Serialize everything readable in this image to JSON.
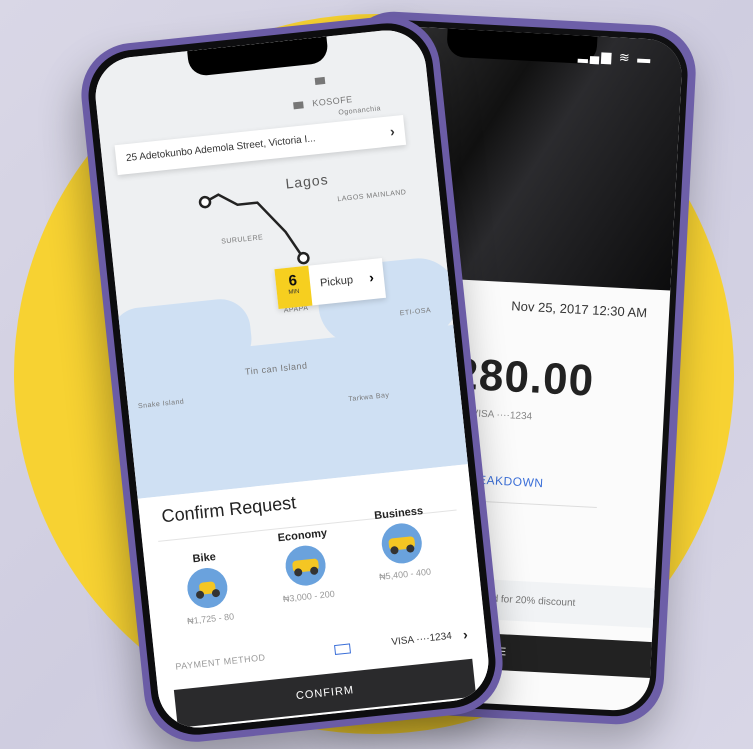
{
  "back_phone": {
    "status_icons": "▂▄▆ ≋ ▬",
    "date": "Nov 25, 2017 12:30 AM",
    "amount": "280.00",
    "card": "VISA ····1234",
    "breakdown_label": "E BREAKDOWN",
    "promo_text": "applied for 20% discount",
    "complete_label": "MPLETE"
  },
  "front_phone": {
    "map": {
      "address": "25 Adetokunbo Ademola Street, Victoria I...",
      "city_label": "Lagos",
      "labels": [
        "KOSOFE",
        "Ogonanchia",
        "LAGOS MAINLAND",
        "SURULERE",
        "APAPA",
        "ETI-OSA",
        "Tin can Island",
        "Snake Island",
        "Tarkwa Bay"
      ],
      "eta_value": "6",
      "eta_unit": "MIN",
      "pickup_label": "Pickup"
    },
    "sheet": {
      "title": "Confirm Request",
      "rides": [
        {
          "name": "Bike",
          "price": "₦1,725 - 80"
        },
        {
          "name": "Economy",
          "price": "₦3,000 - 200"
        },
        {
          "name": "Business",
          "price": "₦5,400 - 400"
        }
      ],
      "payment_label": "PAYMENT METHOD",
      "payment_value": "VISA ····1234",
      "confirm_label": "CONFIRM"
    }
  },
  "colors": {
    "accent": "#f6cf1f",
    "phone_frame": "#6b5ca6",
    "button": "#2a2a2c",
    "link": "#3b6fd8"
  }
}
